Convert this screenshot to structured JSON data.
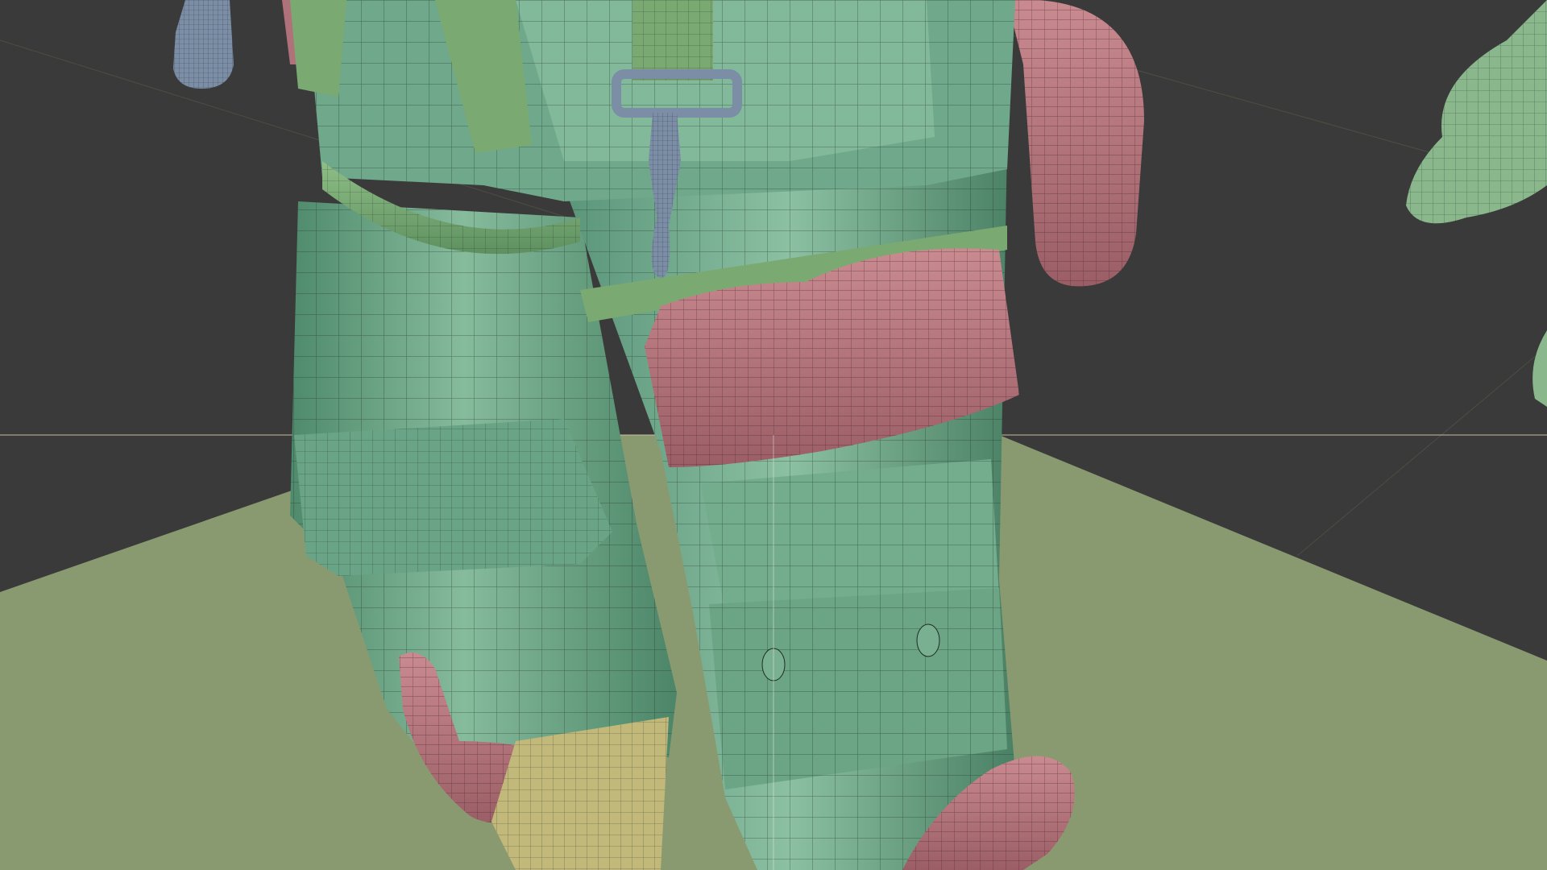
{
  "viewport": {
    "icon": "3d-mesh-viewport-icon",
    "colors": {
      "background": "#3a3a3a",
      "ground_plane": "#8a9a70",
      "grid_line": "#5a5a4a",
      "horizon_line": "#c8c0a0",
      "cloth_green": "#6fa88a",
      "cloth_green_light": "#86bb9c",
      "strap_green": "#7aaa72",
      "pad_pink": "#b0727a",
      "pad_pink_light": "#c4868c",
      "boot_tan": "#c2b87a",
      "metal_blue": "#7c8ea6",
      "wire": "#1e2b24"
    }
  }
}
